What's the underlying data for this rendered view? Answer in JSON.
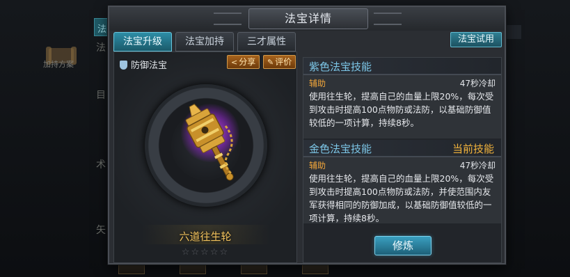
{
  "background": {
    "tab_char": "法",
    "side_chars": [
      "法",
      "目",
      "术",
      "矢"
    ],
    "scroll_label": "加持方案"
  },
  "dialog": {
    "title": "法宝详情"
  },
  "tabs": [
    {
      "label": "法宝升级",
      "active": true
    },
    {
      "label": "法宝加持",
      "active": false
    },
    {
      "label": "三才属性",
      "active": false
    }
  ],
  "trial_button": "法宝试用",
  "item": {
    "type_label": "防御法宝",
    "share_label": "分享",
    "rate_label": "评价",
    "name": "六道往生轮",
    "stars": "☆☆☆☆☆",
    "icon": "golden-prayer-wheel-icon",
    "glow_color": "#c84cf0"
  },
  "skills": [
    {
      "title": "紫色法宝技能",
      "current_label": "",
      "type": "辅助",
      "cooldown": "47秒冷却",
      "description": "使用往生轮，提高自己的血量上限20%，每次受到攻击时提高100点物防或法防，以基础防御值较低的一项计算，持续8秒。"
    },
    {
      "title": "金色法宝技能",
      "current_label": "当前技能",
      "type": "辅助",
      "cooldown": "47秒冷却",
      "description": "使用往生轮，提高自己的血量上限20%，每次受到攻击时提高100点物防或法防，并使范围内友军获得相同的防御加成，以基础防御值较低的一项计算，持续8秒。"
    }
  ],
  "train_button": "修炼",
  "colors": {
    "accent": "#2d8da6",
    "skill_title": "#7dc7e8",
    "gold": "#f2c25c",
    "orange": "#f0a53a"
  }
}
